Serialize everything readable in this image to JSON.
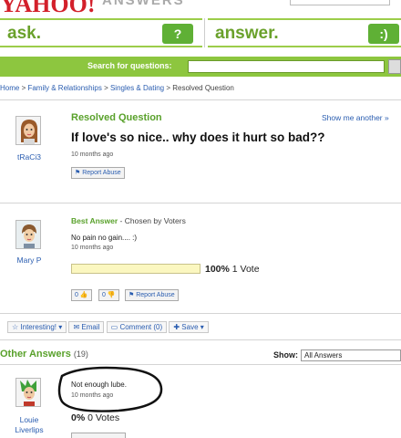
{
  "header": {
    "logo": "YAHOO!",
    "logo_product": "ANSWERS",
    "ask_label": "ask.",
    "answer_label": "answer.",
    "search_label": "Search for questions:"
  },
  "breadcrumb": {
    "home": "Home",
    "cat": "Family & Relationships",
    "sub": "Singles & Dating",
    "current": "Resolved Question",
    "sep": " > "
  },
  "question": {
    "status": "Resolved Question",
    "show_me": "Show me another »",
    "title": "If love's so nice.. why does it hurt so bad??",
    "time": "10 months ago",
    "report": "Report Abuse",
    "asker": "tRaCi3"
  },
  "best_answer": {
    "heading": "Best Answer",
    "chosen": " - Chosen by Voters",
    "text": "No pain no gain.... :)",
    "time": "10 months ago",
    "user": "Mary P",
    "vote_percent_text": "100%",
    "vote_percent": 1.0,
    "vote_count": "1 Vote",
    "thumbs_up": "0",
    "thumbs_down": "0",
    "report": "Report Abuse"
  },
  "actions": {
    "interesting": "Interesting!",
    "email": "Email",
    "comment": "Comment (0)",
    "save": "Save"
  },
  "other_answers": {
    "heading": "Other Answers",
    "count": "(19)",
    "show_label": "Show:",
    "show_value": "All Answers",
    "first": {
      "text": "Not enough lube.",
      "time": "10 months ago",
      "user_line1": "Louie",
      "user_line2": "Liverlips",
      "vote_percent": "0%",
      "votes": "0 Votes"
    }
  },
  "colors": {
    "accent_green": "#59a12b",
    "bar_green": "#8dc63f",
    "link_blue": "#2a5db0",
    "yahoo_red": "#d3202b"
  }
}
